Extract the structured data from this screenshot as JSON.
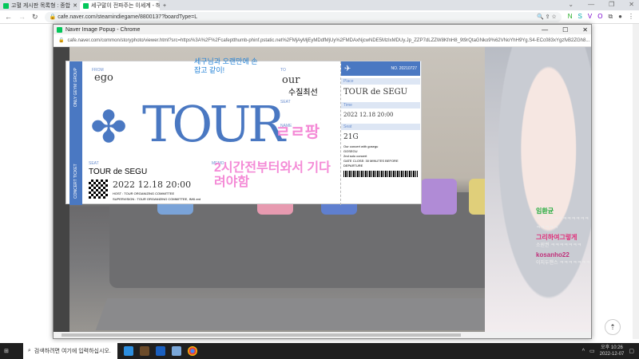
{
  "browser": {
    "tabs": [
      {
        "label": "고혈 게시판 목록형 : 종합"
      },
      {
        "label": "세구말이 전파주는 이세계 - 해고"
      }
    ],
    "url": "cafe.naver.com/steamindiegame/8800137?boardType=L",
    "window_controls": [
      "⌄",
      "—",
      "❐",
      "✕"
    ],
    "extensions": [
      "N",
      "S",
      "V",
      "O"
    ]
  },
  "popup": {
    "title": "Naver Image Popup - Chrome",
    "url": "cafe.naver.com/common/storyphoto/viewer.html?src=https%3A%2F%2Fcafeptthumb-phinf.pstatic.net%2FMjAyMjEyMDdfMjUy%2FMDAxNjcwNDE5MzIxMDUy.Jp_ZZP7dLZZW8KfnH8_9t9rQtaGNko9%62VNoYhH9Yg.S4-ECc083xYgzfvB2ZGh8..."
  },
  "ticket": {
    "side_top": "ONLY GEYM GROUP",
    "side_bottom": "CONCERT TICKET",
    "from_label": "FROM",
    "from": "ego",
    "to_label": "TO",
    "to": "our",
    "seat_label": "SEAT",
    "name_label": "NAME",
    "big_title": "TOUR",
    "seat2_label": "SEAT",
    "seat_value": "TOUR de SEGU",
    "memo_label": "MEMO",
    "date": "2022 12.18 20:00",
    "host": "HOST : TOUR ORGANIZING COMMITTEE",
    "supervision": "SUPERVISION : TOUR ORGANIZING COMMITTEE, INKI.ent",
    "right": {
      "no": "NO. 20210727",
      "place_label": "Place",
      "place": "TOUR de SEGU",
      "time_label": "Time",
      "time": "2022 12.18 20:00",
      "seat_label": "Seat",
      "seat": "21G",
      "desc1": "Our concert with gosegu",
      "desc2": "GOSEGU",
      "desc3": "2nd solo concert",
      "gate": "GATE CLOSE: 30 MINUTES BEFORE DEPARTURE"
    }
  },
  "handwriting": {
    "blue": "세구님과 오랜만에 손잡고 같이!",
    "black": "수질최선",
    "name": "ㄹㄹ팡",
    "memo": "2시간전부터와서 기다려야함"
  },
  "chat": [
    {
      "user": "임환균",
      "msg": "ㅋㅋㅋㅋㅋㅋㅋㅋㅋㅋㅋㅋㅋㅋㅋㅋㅋ",
      "color": "#1faa3a"
    },
    {
      "user": "그리하여그렇게",
      "msg": "소원권 ㅋㅋㅋㅋㅋㅋㅋ",
      "color": "#e0307a"
    },
    {
      "user": "kosanho22",
      "msg": "이지두핸스 ㅋㅋㅋㅋㅋㅋㅋ",
      "color": "#c0307a"
    }
  ],
  "taskbar": {
    "search_placeholder": "검색하려면 여기에 입력하십시오.",
    "time": "오후 10:26",
    "date": "2022-12-07"
  }
}
